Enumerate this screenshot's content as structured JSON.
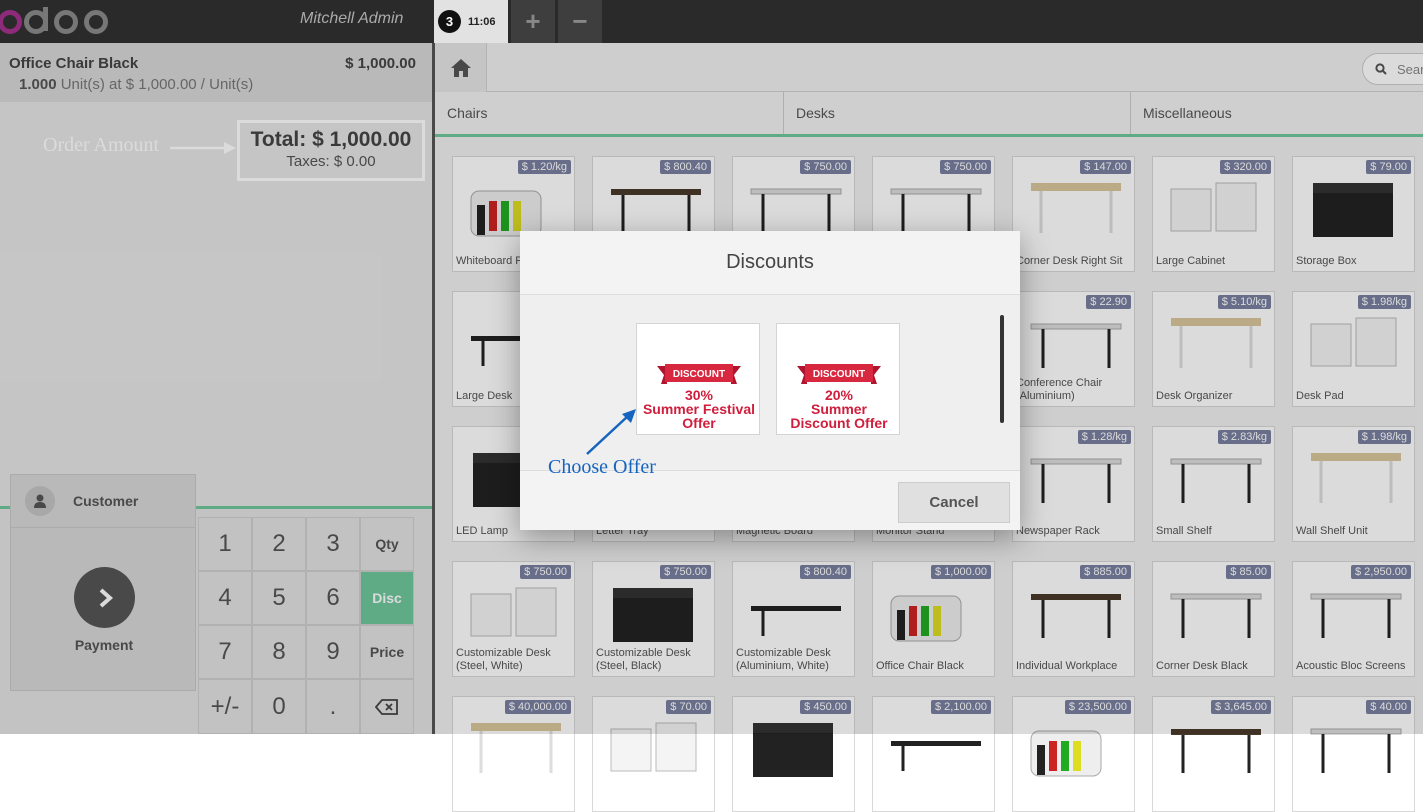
{
  "topbar": {
    "logo": "odoo",
    "user": "Mitchell Admin",
    "order_number": "3",
    "order_time": "11:06",
    "add_order": "+",
    "remove_order": "−"
  },
  "order": {
    "line": {
      "name": "Office Chair Black",
      "price": "$ 1,000.00",
      "qty": "1.000",
      "unit_info": "Unit(s) at $ 1,000.00 / Unit(s)"
    },
    "total": "Total: $ 1,000.00",
    "taxes": "Taxes: $ 0.00"
  },
  "annotations": {
    "order_amount": "Order Amount",
    "choose_offer": "Choose Offer"
  },
  "actionpad": {
    "customer": "Customer",
    "payment": "Payment"
  },
  "numpad": {
    "keys": [
      "1",
      "2",
      "3",
      "4",
      "5",
      "6",
      "7",
      "8",
      "9",
      "+/-",
      "0",
      "."
    ],
    "modes": [
      "Qty",
      "Disc",
      "Price"
    ],
    "active_mode": "Disc"
  },
  "search": {
    "placeholder": "Sear"
  },
  "categories": [
    "Chairs",
    "Desks",
    "Miscellaneous"
  ],
  "products": [
    {
      "name": "Whiteboard P",
      "price": "$ 1.20/kg"
    },
    {
      "name": "",
      "price": "$ 800.40"
    },
    {
      "name": "",
      "price": "$ 750.00"
    },
    {
      "name": "",
      "price": "$ 750.00"
    },
    {
      "name": "Corner Desk Right Sit",
      "price": "$ 147.00"
    },
    {
      "name": "Large Cabinet",
      "price": "$ 320.00"
    },
    {
      "name": "Storage Box",
      "price": "$ 79.00"
    },
    {
      "name": "Large Desk",
      "price": "$"
    },
    {
      "name": "",
      "price": ""
    },
    {
      "name": "",
      "price": ""
    },
    {
      "name": "",
      "price": ""
    },
    {
      "name": "Conference Chair (Aluminium)",
      "price": "$ 22.90"
    },
    {
      "name": "Desk Organizer",
      "price": "$ 5.10/kg"
    },
    {
      "name": "Desk Pad",
      "price": "$ 1.98/kg"
    },
    {
      "name": "LED Lamp",
      "price": "$"
    },
    {
      "name": "Letter Tray",
      "price": ""
    },
    {
      "name": "Magnetic Board",
      "price": ""
    },
    {
      "name": "Monitor Stand",
      "price": ""
    },
    {
      "name": "Newspaper Rack",
      "price": "$ 1.28/kg"
    },
    {
      "name": "Small Shelf",
      "price": "$ 2.83/kg"
    },
    {
      "name": "Wall Shelf Unit",
      "price": "$ 1.98/kg"
    },
    {
      "name": "Customizable Desk (Steel, White)",
      "price": "$ 750.00"
    },
    {
      "name": "Customizable Desk (Steel, Black)",
      "price": "$ 750.00"
    },
    {
      "name": "Customizable Desk (Aluminium, White)",
      "price": "$ 800.40"
    },
    {
      "name": "Office Chair Black",
      "price": "$ 1,000.00"
    },
    {
      "name": "Individual Workplace",
      "price": "$ 885.00"
    },
    {
      "name": "Corner Desk Black",
      "price": "$ 85.00"
    },
    {
      "name": "Acoustic Bloc Screens",
      "price": "$ 2,950.00"
    },
    {
      "name": "",
      "price": "$ 40,000.00"
    },
    {
      "name": "",
      "price": "$ 70.00"
    },
    {
      "name": "",
      "price": "$ 450.00"
    },
    {
      "name": "",
      "price": "$ 2,100.00"
    },
    {
      "name": "",
      "price": "$ 23,500.00"
    },
    {
      "name": "",
      "price": "$ 3,645.00"
    },
    {
      "name": "",
      "price": "$ 40.00"
    }
  ],
  "modal": {
    "title": "Discounts",
    "offers": [
      {
        "badge": "DISCOUNT",
        "line1": "30%",
        "line2": "Summer Festival",
        "line3": "Offer"
      },
      {
        "badge": "DISCOUNT",
        "line1": "20%",
        "line2": "Summer",
        "line3": "Discount Offer"
      }
    ],
    "cancel": "Cancel"
  },
  "colors": {
    "accent": "#6ec89b",
    "offer_red": "#d01e3c",
    "annotation_blue": "#1565c0"
  }
}
